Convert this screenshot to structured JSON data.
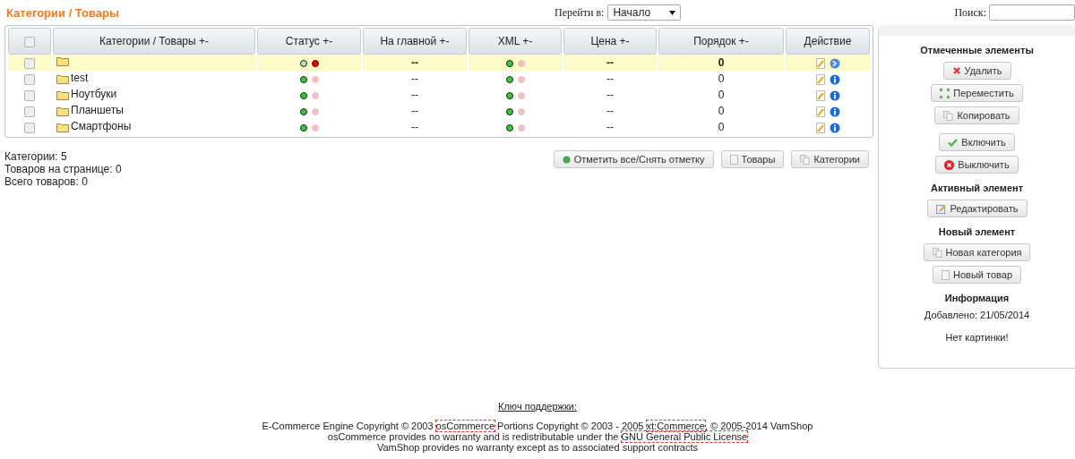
{
  "header": {
    "title": "Категории / Товары",
    "goto": {
      "label": "Перейти в:",
      "value": "Начало"
    },
    "search": {
      "label": "Поиск:"
    }
  },
  "table": {
    "select_all_checked": false,
    "columns": [
      "Категории / Товары +-",
      "Статус +-",
      "На главной +-",
      "XML +-",
      "Цена +-",
      "Порядок +-",
      "Действие"
    ],
    "rows": [
      {
        "name": "",
        "selected": true,
        "checked": false,
        "active": false,
        "main": "--",
        "xml": true,
        "price": "--",
        "order": "0"
      },
      {
        "name": "test",
        "selected": false,
        "checked": false,
        "active": true,
        "main": "--",
        "xml": true,
        "price": "--",
        "order": "0"
      },
      {
        "name": "Ноутбуки",
        "selected": false,
        "checked": false,
        "active": true,
        "main": "--",
        "xml": true,
        "price": "--",
        "order": "0"
      },
      {
        "name": "Планшеты",
        "selected": false,
        "checked": false,
        "active": true,
        "main": "--",
        "xml": true,
        "price": "--",
        "order": "0"
      },
      {
        "name": "Смартфоны",
        "selected": false,
        "checked": false,
        "active": true,
        "main": "--",
        "xml": true,
        "price": "--",
        "order": "0"
      }
    ]
  },
  "summary": [
    "Категории: 5",
    "Товаров на странице: 0",
    "Всего товаров: 0"
  ],
  "table_buttons": [
    {
      "kind": "select",
      "label": "Отметить все/Снять отметку"
    },
    {
      "kind": "product",
      "label": "Товары"
    },
    {
      "kind": "copy",
      "label": "Категории"
    }
  ],
  "side_panel": {
    "sections": [
      {
        "heading": "Отмеченные элементы",
        "buttons": [
          {
            "kind": "delete",
            "label": "Удалить"
          },
          {
            "kind": "move",
            "label": "Переместить"
          },
          {
            "kind": "copy",
            "label": "Копировать"
          },
          {
            "kind": "enable",
            "label": "Включить"
          },
          {
            "kind": "disable",
            "label": "Выключить"
          }
        ]
      },
      {
        "heading": "Активный элемент",
        "buttons": [
          {
            "kind": "edit",
            "label": "Редактировать"
          }
        ]
      },
      {
        "heading": "Новый элемент",
        "buttons": [
          {
            "kind": "copy",
            "label": "Новая категория"
          },
          {
            "kind": "product",
            "label": "Новый товар"
          }
        ]
      },
      {
        "heading": "Информация",
        "lines": [
          "Добавлено: 21/05/2014",
          "Нет картинки!"
        ]
      }
    ]
  },
  "footer": {
    "support_key": "Ключ поддержки:",
    "lines": [
      [
        {
          "kind": "text",
          "text": "E-Commerce Engine Copyright © 2003 "
        },
        {
          "kind": "link",
          "text": "osCommerce"
        },
        {
          "kind": "text",
          "text": " Portions Copyright © 2003 - 2005 "
        },
        {
          "kind": "link",
          "text": "xt:Commerce"
        },
        {
          "kind": "text",
          "text": ", © 2005-2014 VamShop"
        }
      ],
      [
        {
          "kind": "text",
          "text": "osCommerce provides no warranty and is redistributable under the "
        },
        {
          "kind": "link",
          "text": "GNU General Public License"
        }
      ],
      [
        {
          "kind": "text",
          "text": "VamShop provides no warranty except as to associated support contracts"
        }
      ]
    ]
  }
}
